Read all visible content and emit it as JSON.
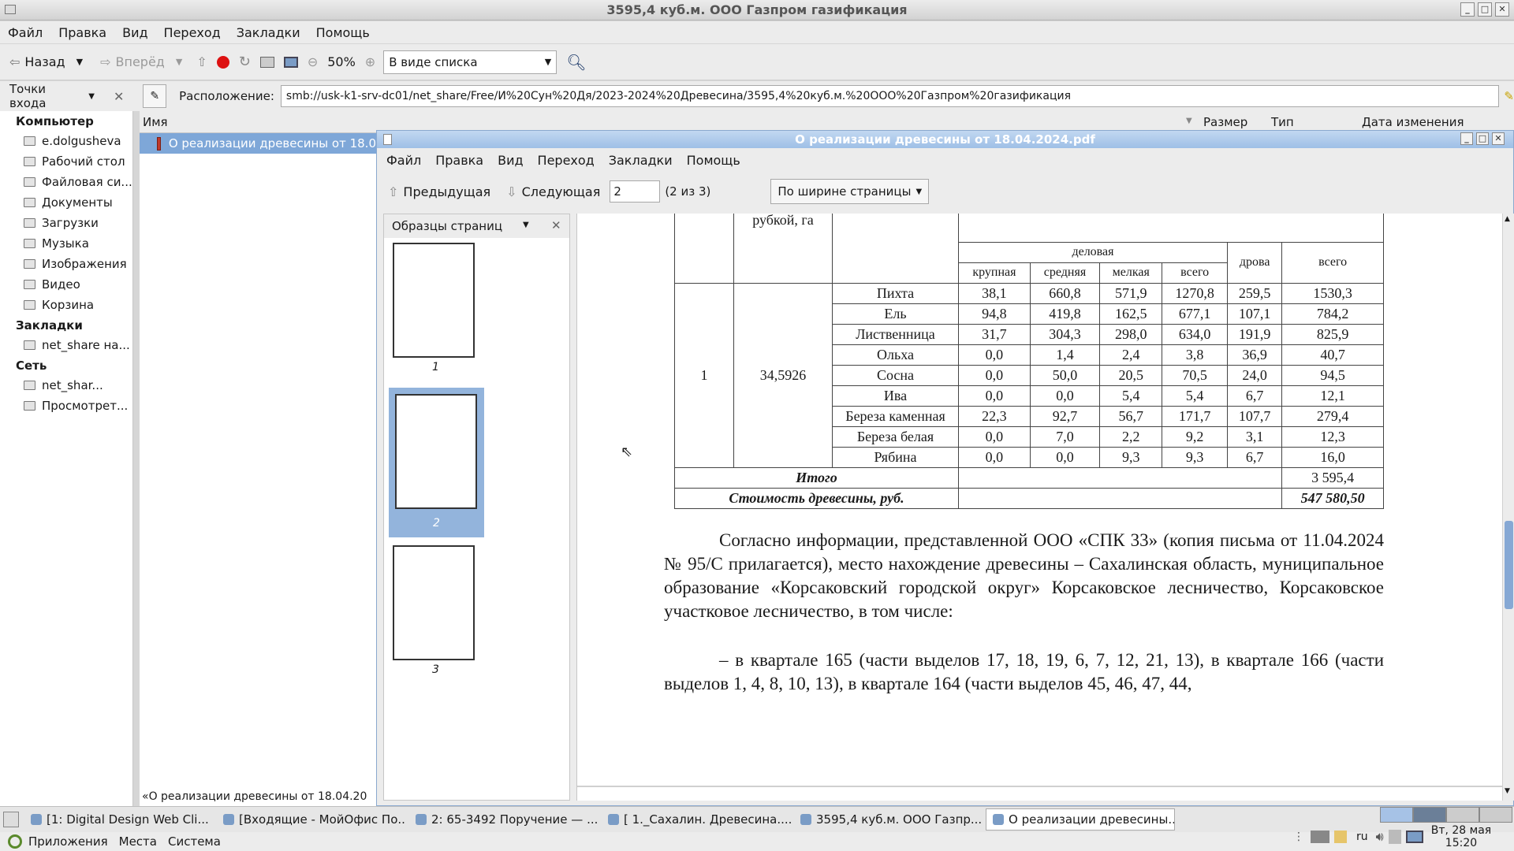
{
  "window": {
    "title": "3595,4 куб.м. ООО Газпром газификация"
  },
  "menu": [
    "Файл",
    "Правка",
    "Вид",
    "Переход",
    "Закладки",
    "Помощь"
  ],
  "toolbar": {
    "back": "Назад",
    "forward": "Вперёд",
    "zoom": "50%",
    "view_mode": "В виде списка"
  },
  "location": {
    "places_label": "Точки входа",
    "label": "Расположение:",
    "path": "smb://usk-k1-srv-dc01/net_share/Free/И%20Сун%20Дя/2023-2024%20Древесина/3595,4%20куб.м.%20ООО%20Газпром%20газификация"
  },
  "sidebar": {
    "computer_header": "Компьютер",
    "computer_items": [
      "e.dolgusheva",
      "Рабочий стол",
      "Файловая си...",
      "Документы",
      "Загрузки",
      "Музыка",
      "Изображения",
      "Видео",
      "Корзина"
    ],
    "bookmarks_header": "Закладки",
    "bookmarks_items": [
      "net_share на..."
    ],
    "network_header": "Сеть",
    "network_items": [
      "net_shar...",
      "Просмотрет..."
    ]
  },
  "filelist": {
    "col_name": "Имя",
    "col_size": "Размер",
    "col_type": "Тип",
    "col_date": "Дата изменения",
    "selected_file": "О реализации древесины от 18.0",
    "status": "«О реализации древесины от 18.04.20"
  },
  "pdf": {
    "title": "О реализации древесины от 18.04.2024.pdf",
    "menu": [
      "Файл",
      "Правка",
      "Вид",
      "Переход",
      "Закладки",
      "Помощь"
    ],
    "prev": "Предыдущая",
    "next": "Следующая",
    "page": "2",
    "page_of": "(2 из 3)",
    "zoom_mode": "По ширине страницы",
    "thumbs_label": "Образцы страниц",
    "thumbs": [
      "1",
      "2",
      "3"
    ],
    "table": {
      "header_top": "рубкой, га",
      "header_group": "деловая",
      "header_cols": [
        "крупная",
        "средняя",
        "мелкая",
        "всего",
        "дрова",
        "всего"
      ],
      "row_num": "1",
      "area": "34,5926",
      "rows": [
        [
          "Пихта",
          "38,1",
          "660,8",
          "571,9",
          "1270,8",
          "259,5",
          "1530,3"
        ],
        [
          "Ель",
          "94,8",
          "419,8",
          "162,5",
          "677,1",
          "107,1",
          "784,2"
        ],
        [
          "Лиственница",
          "31,7",
          "304,3",
          "298,0",
          "634,0",
          "191,9",
          "825,9"
        ],
        [
          "Ольха",
          "0,0",
          "1,4",
          "2,4",
          "3,8",
          "36,9",
          "40,7"
        ],
        [
          "Сосна",
          "0,0",
          "50,0",
          "20,5",
          "70,5",
          "24,0",
          "94,5"
        ],
        [
          "Ива",
          "0,0",
          "0,0",
          "5,4",
          "5,4",
          "6,7",
          "12,1"
        ],
        [
          "Береза каменная",
          "22,3",
          "92,7",
          "56,7",
          "171,7",
          "107,7",
          "279,4"
        ],
        [
          "Береза белая",
          "0,0",
          "7,0",
          "2,2",
          "9,2",
          "3,1",
          "12,3"
        ],
        [
          "Рябина",
          "0,0",
          "0,0",
          "9,3",
          "9,3",
          "6,7",
          "16,0"
        ]
      ],
      "total_label": "Итого",
      "total_value": "3 595,4",
      "cost_label": "Стоимость древесины, руб.",
      "cost_value": "547 580,50"
    },
    "para1": "Согласно информации, представленной ООО «СПК 33» (копия письма от 11.04.2024 № 95/С прилагается), место нахождение древесины – Сахалинская область, муниципальное образование «Корсаковский городской округ» Корсаковское лесничество, Корсаковское участковое лесничество, в том числе:",
    "para2": "–        в квартале 165 (части выделов 17, 18, 19, 6, 7, 12, 21, 13), в квартале 166 (части выделов 1, 4, 8, 10, 13), в квартале 164 (части выделов 45, 46, 47, 44,"
  },
  "taskbar": {
    "tasks": [
      "[1: Digital Design Web Cli...",
      "[Входящие - МойОфис По...",
      "2: 65-3492 Поручение — ...",
      "[ 1._Сахалин. Древесина....",
      "3595,4 куб.м. ООО Газпр...",
      "О реализации древесины..."
    ],
    "lang": "ru",
    "date": "Вт, 28 мая",
    "time": "15:20"
  },
  "bottom": {
    "apps": "Приложения",
    "places": "Места",
    "system": "Система"
  }
}
